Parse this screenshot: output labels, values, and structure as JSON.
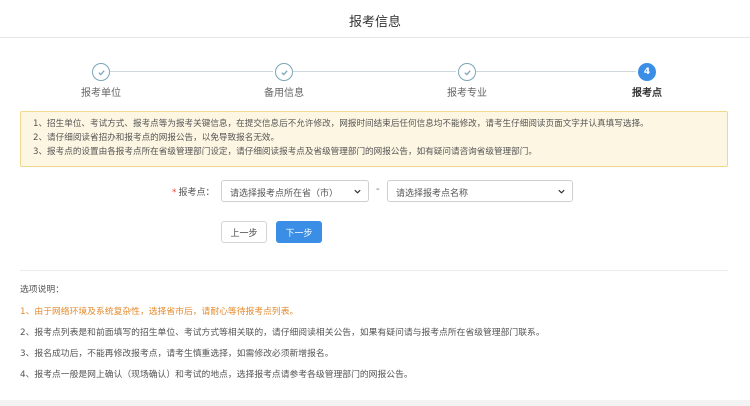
{
  "header": {
    "title": "报考信息"
  },
  "steps": [
    {
      "label": "报考单位",
      "state": "done"
    },
    {
      "label": "备用信息",
      "state": "done"
    },
    {
      "label": "报考专业",
      "state": "done"
    },
    {
      "label": "报考点",
      "state": "active",
      "number": "4"
    }
  ],
  "notice": {
    "lines": [
      "1、招生单位、考试方式、报考点等为报考关键信息，在提交信息后不允许修改，网报时间结束后任何信息均不能修改，请考生仔细阅读页面文字并认真填写选择。",
      "2、请仔细阅读省招办和报考点的网报公告，以免导致报名无效。",
      "3、报考点的设置由各报考点所在省级管理部门设定，请仔细阅读报考点及省级管理部门的网报公告，如有疑问请咨询省级管理部门。"
    ]
  },
  "form": {
    "required_mark": "*",
    "label": "报考点：",
    "province_select": "请选择报考点所在省（市）",
    "dash": "-",
    "site_select": "请选择报考点名称"
  },
  "buttons": {
    "prev": "上一步",
    "next": "下一步"
  },
  "options": {
    "title": "选项说明：",
    "items": [
      "1、由于网络环境及系统复杂性，选择省市后，请耐心等待报考点列表。",
      "2、报考点列表是和前面填写的招生单位、考试方式等相关联的，请仔细阅读相关公告，如果有疑问请与报考点所在省级管理部门联系。",
      "3、报名成功后，不能再修改报考点，请考生慎重选择，如需修改必须新增报名。",
      "4、报考点一般是网上确认（现场确认）和考试的地点，选择报考点请参考各级管理部门的网报公告。"
    ]
  },
  "colors": {
    "accent": "#3a8ee6",
    "notice_bg": "#fdf6e3",
    "highlight": "#e38b2f"
  }
}
